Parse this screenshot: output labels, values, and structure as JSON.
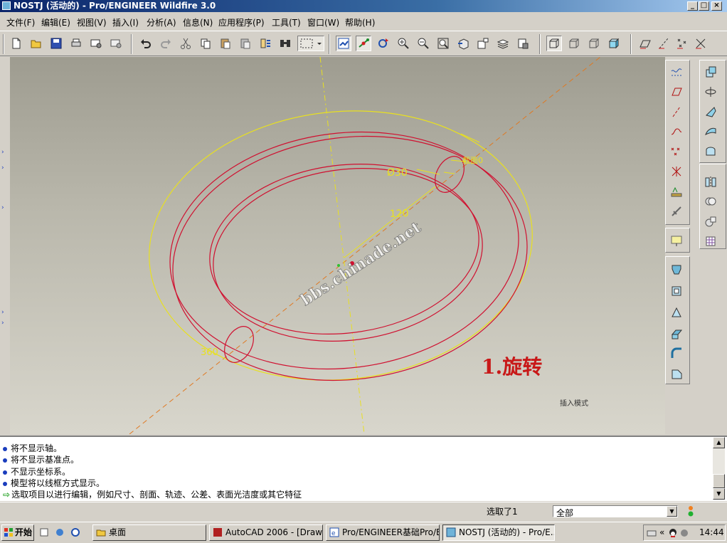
{
  "window": {
    "title": "NOSTJ (活动的) - Pro/ENGINEER Wildfire 3.0"
  },
  "menu": [
    {
      "label": "文件(F)"
    },
    {
      "label": "编辑(E)"
    },
    {
      "label": "视图(V)"
    },
    {
      "label": "插入(I)"
    },
    {
      "label": "分析(A)"
    },
    {
      "label": "信息(N)"
    },
    {
      "label": "应用程序(P)"
    },
    {
      "label": "工具(T)"
    },
    {
      "label": "窗口(W)"
    },
    {
      "label": "帮助(H)"
    }
  ],
  "canvas": {
    "watermark": "bbs.chinade.net",
    "dim_diameter": "Ø30",
    "dim_radius": "120",
    "dim_angle": "360",
    "plane_label": "截面0",
    "annotation": "1.旋转",
    "insert_mode": "插入模式",
    "colors": {
      "section_lines": "#d01030",
      "datum_lines": "#e8e020",
      "axis_dashed": "#e07820",
      "annotation": "#c81818"
    }
  },
  "messages": [
    {
      "text": "将不显示轴。",
      "type": "info"
    },
    {
      "text": "将不显示基准点。",
      "type": "info"
    },
    {
      "text": "不显示坐标系。",
      "type": "info"
    },
    {
      "text": "模型将以线框方式显示。",
      "type": "info"
    },
    {
      "text": "选取项目以进行编辑，例如尺寸、剖面、轨迹、公差、表面光洁度或其它特征",
      "type": "prompt"
    }
  ],
  "status": {
    "selected": "选取了1",
    "filter": "全部"
  },
  "taskbar": {
    "start": "开始",
    "tasks": [
      {
        "label": "桌面"
      },
      {
        "label": "AutoCAD 2006 - [Drawin..."
      },
      {
        "label": "Pro/ENGINEER基础Pro/E..."
      },
      {
        "label": "NOSTJ (活动的) - Pro/E..."
      }
    ],
    "clock": "14:44"
  },
  "icons": {
    "toolbar": [
      "new-icon",
      "open-icon",
      "save-icon",
      "print-icon",
      "send-mail-icon",
      "send-mail-2-icon",
      "undo-icon",
      "redo-icon",
      "cut-icon",
      "copy-icon",
      "paste-icon",
      "paste-special-icon",
      "regenerate-icon",
      "model-tree-icon",
      "select-box-icon",
      "repaint-icon",
      "datum-point-toggle-icon",
      "orient-icon",
      "zoom-in-icon",
      "zoom-out-icon",
      "refit-icon",
      "view-manager-icon",
      "saved-views-icon",
      "layers-icon",
      "appearance-icon",
      "wireframe-icon",
      "hidden-line-icon",
      "no-hidden-icon",
      "shading-icon",
      "datum-plane-display-icon",
      "datum-axis-display-icon",
      "datum-point-display-icon",
      "csys-display-icon"
    ],
    "right": [
      "sketched-curve-icon",
      "datum-plane-icon",
      "datum-axis-icon",
      "datum-curve-icon",
      "datum-point-icon",
      "csys-icon",
      "analysis-icon",
      "insert-feature-icon",
      "extrude-icon",
      "revolve-icon",
      "sweep-icon",
      "blend-icon",
      "boundary-icon",
      "hole-icon",
      "shell-icon",
      "rib-icon",
      "draft-icon",
      "round-icon",
      "chamfer-icon",
      "pattern-icon",
      "mirror-icon",
      "merge-icon",
      "trim-icon",
      "offset-icon",
      "thicken-icon",
      "solidify-icon"
    ]
  }
}
